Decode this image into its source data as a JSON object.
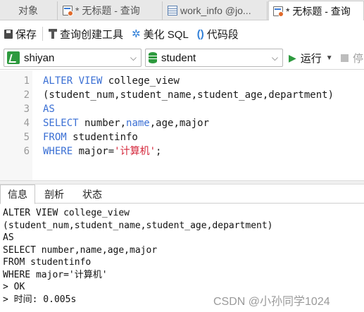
{
  "tabs": [
    {
      "label": "对象",
      "icon": "none"
    },
    {
      "label": "* 无标题 - 查询",
      "icon": "query-icon"
    },
    {
      "label": "work_info @jo...",
      "icon": "table-icon"
    },
    {
      "label": "* 无标题 - 查询",
      "icon": "query-icon",
      "active": true
    }
  ],
  "toolbar": {
    "save": "保存",
    "query_builder": "查询创建工具",
    "beautify": "美化 SQL",
    "snippet": "代码段"
  },
  "selectors": {
    "connection": "shiyan",
    "database": "student",
    "run": "运行",
    "stop": "停"
  },
  "editor": {
    "lines": [
      {
        "num": "1",
        "parts": [
          {
            "t": "ALTER VIEW",
            "c": "kw"
          },
          {
            "t": " college_view",
            "c": ""
          }
        ]
      },
      {
        "num": "2",
        "parts": [
          {
            "t": "(student_num,student_name,student_age,department)",
            "c": ""
          }
        ]
      },
      {
        "num": "3",
        "parts": [
          {
            "t": "AS",
            "c": "kw"
          }
        ]
      },
      {
        "num": "4",
        "parts": [
          {
            "t": "SELECT",
            "c": "kw"
          },
          {
            "t": " number,",
            "c": ""
          },
          {
            "t": "name",
            "c": "kw"
          },
          {
            "t": ",age,major",
            "c": ""
          }
        ]
      },
      {
        "num": "5",
        "parts": [
          {
            "t": "FROM",
            "c": "kw"
          },
          {
            "t": " studentinfo",
            "c": ""
          }
        ]
      },
      {
        "num": "6",
        "parts": [
          {
            "t": "WHERE",
            "c": "kw"
          },
          {
            "t": " major=",
            "c": ""
          },
          {
            "t": "'计算机'",
            "c": "str"
          },
          {
            "t": ";",
            "c": ""
          }
        ]
      }
    ]
  },
  "result_tabs": [
    "信息",
    "剖析",
    "状态"
  ],
  "output": {
    "lines": [
      "ALTER VIEW college_view",
      "(student_num,student_name,student_age,department)",
      "AS",
      "SELECT number,name,age,major",
      "FROM studentinfo",
      "WHERE major='计算机'",
      "> OK",
      "> 时间: 0.005s"
    ]
  },
  "watermark": "CSDN @小孙同学1024",
  "colors": {
    "keyword": "#3a6fd4",
    "string": "#d4263a",
    "accent_green": "#2d9a3e"
  }
}
